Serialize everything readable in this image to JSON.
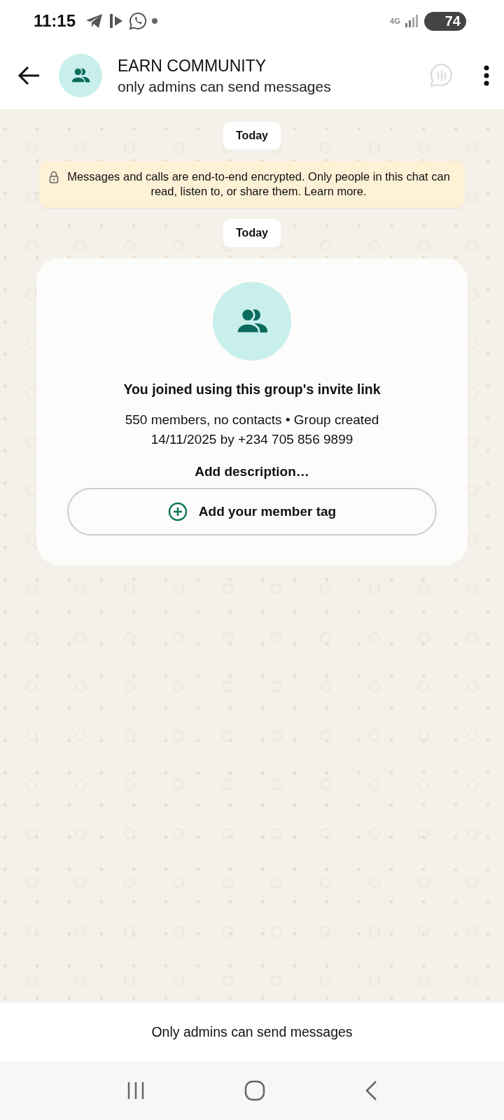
{
  "status_bar": {
    "time": "11:15",
    "network": "4G",
    "battery": "74"
  },
  "header": {
    "title": "EARN COMMUNITY",
    "subtitle": "only admins can send messages"
  },
  "chat": {
    "date_chips": [
      "Today",
      "Today"
    ],
    "encryption_notice": {
      "text": "Messages and calls are end-to-end encrypted. Only people in this chat can read, listen to, or share them.",
      "link": "Learn more."
    },
    "group_card": {
      "heading": "You joined using this group's invite link",
      "details": "550 members, no contacts • Group created 14/11/2025 by +234 705 856 9899",
      "description_link": "Add description…",
      "member_tag_button": "Add your member tag"
    }
  },
  "footer": {
    "notice": "Only admins can send messages"
  }
}
